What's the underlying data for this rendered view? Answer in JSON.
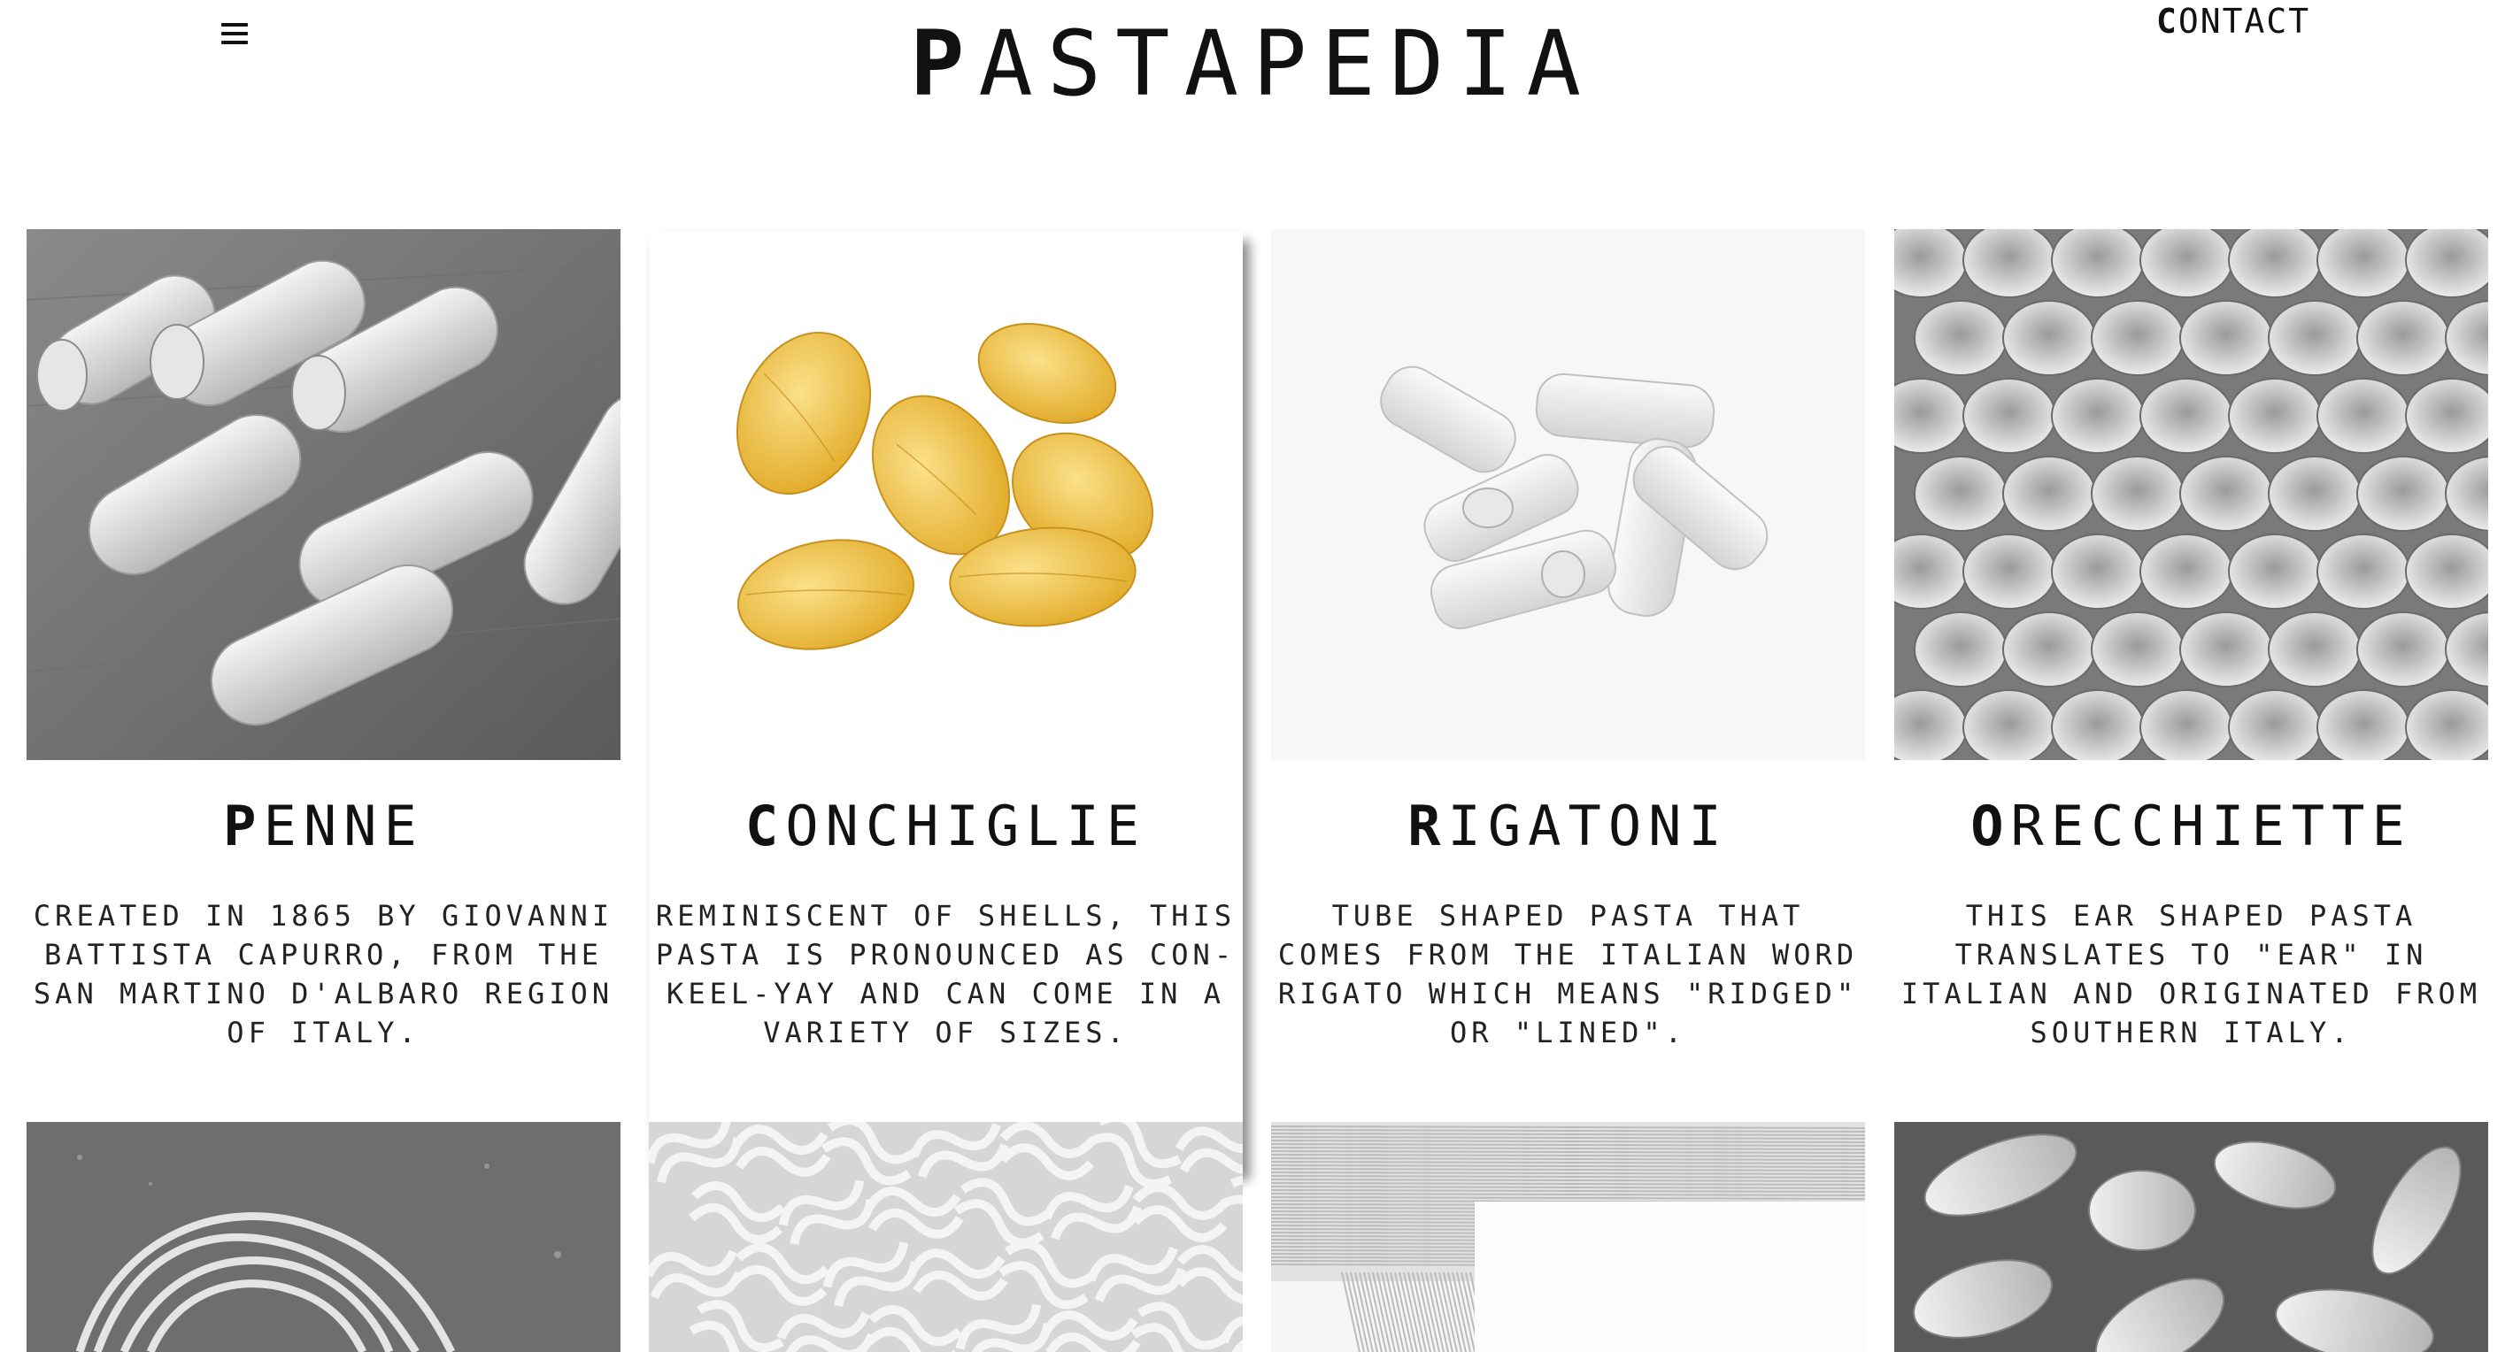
{
  "header": {
    "logo_text": "PASTAPEDIA",
    "contact_label": "CONTACT",
    "menu_icon": "hamburger-icon"
  },
  "pastas": [
    {
      "name": "PENNE",
      "description": "Created in 1865 by Giovanni Battista Capurro, from the San Martino d'Albaro region of Italy.",
      "image": "grayscale penne pasta on wood"
    },
    {
      "name": "CONCHIGLIE",
      "description": "Reminiscent of shells, this pasta is pronounced as con-keel-yay and can come in a variety of sizes.",
      "image": "yellow conchiglie shells"
    },
    {
      "name": "RIGATONI",
      "description": "Tube shaped pasta that comes from the Italian word rigato which means \"ridged\" or \"lined\".",
      "image": "grayscale rigatoni pile"
    },
    {
      "name": "ORECCHIETTE",
      "description": "This ear shaped pasta translates to \"ear\" in Italian and originated from Southern Italy.",
      "image": "grayscale orecchiette heap"
    }
  ],
  "second_row": [
    {
      "image": "grayscale tagliatelle nest"
    },
    {
      "image": "grayscale fusilli spirals"
    },
    {
      "image": "grayscale spaghetti strands"
    },
    {
      "image": "grayscale cavatelli on wood"
    }
  ],
  "colors": {
    "highlight_pasta": "#f2c23a",
    "text": "#111111",
    "background": "#ffffff"
  }
}
